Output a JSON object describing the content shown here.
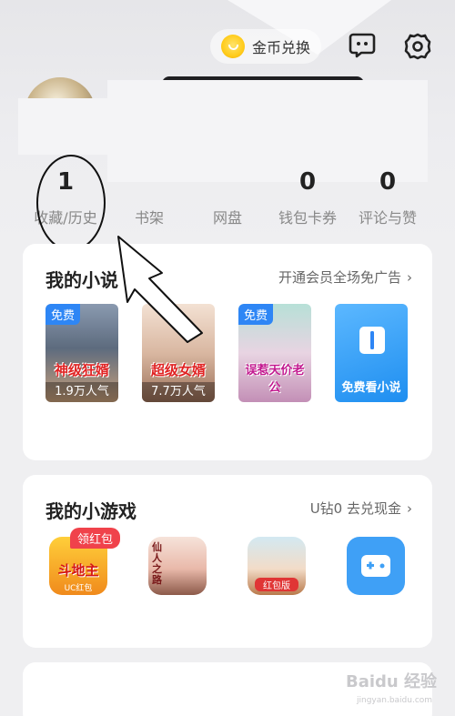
{
  "header": {
    "coin_exchange_label": "金币兑换",
    "icons": [
      "coin-icon",
      "message-icon",
      "settings-icon"
    ]
  },
  "stats": [
    {
      "value": "1",
      "label": "收藏/历史"
    },
    {
      "value": "",
      "label": "书架"
    },
    {
      "value": "",
      "label": "网盘"
    },
    {
      "value": "0",
      "label": "钱包卡券"
    },
    {
      "value": "0",
      "label": "评论与赞"
    }
  ],
  "novels_card": {
    "title": "我的小说",
    "link": "开通会员全场免广告",
    "items": [
      {
        "badge": "免费",
        "cover_title": "神级狂婿",
        "popularity": "1.9万人气"
      },
      {
        "badge": "",
        "cover_title": "超级女婿",
        "popularity": "7.7万人气"
      },
      {
        "badge": "免费",
        "cover_title": "误惹天价老公",
        "popularity": ""
      }
    ],
    "free_read_label": "免费看小说"
  },
  "games_card": {
    "title": "我的小游戏",
    "link": "U钻0 去兑现金",
    "red_packet_badge": "领红包",
    "games": [
      {
        "art_text": "斗地主",
        "sub": "UC红包"
      },
      {
        "art_text": "仙人之路",
        "sub": ""
      },
      {
        "art_text": "",
        "sub": "红包版"
      }
    ]
  },
  "watermark": {
    "text": "Baidu 经验",
    "sub": "jingyan.baidu.com"
  },
  "colors": {
    "accent_blue": "#2e86f5",
    "red": "#f0424b",
    "coin": "#ffcc1c"
  }
}
